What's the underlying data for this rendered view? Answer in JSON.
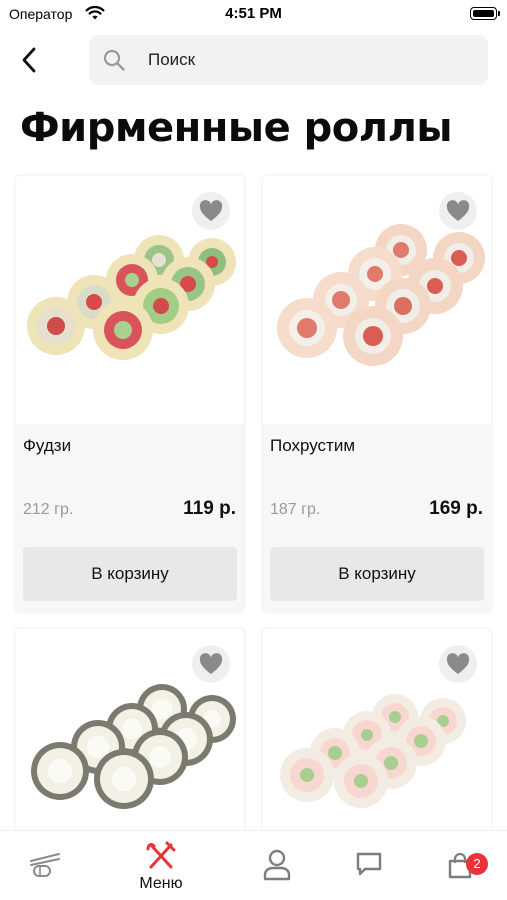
{
  "status_bar": {
    "carrier": "Оператор",
    "time": "4:51 PM"
  },
  "header": {
    "search_placeholder": "Поиск"
  },
  "page": {
    "title": "Фирменные роллы"
  },
  "colors": {
    "accent": "#e8333a",
    "card_bg": "#f7f7f7",
    "button_bg": "#e8e8e8",
    "muted_text": "#9a9a9a"
  },
  "products": [
    {
      "name": "Фудзи",
      "weight": "212 гр.",
      "price": "119 р.",
      "button_label": "В корзину",
      "icon": "heart-icon"
    },
    {
      "name": "Похрустим",
      "weight": "187 гр.",
      "price": "169 р.",
      "button_label": "В корзину",
      "icon": "heart-icon"
    },
    {
      "name": "",
      "weight": "",
      "price": "",
      "button_label": "",
      "icon": "heart-icon"
    },
    {
      "name": "",
      "weight": "",
      "price": "",
      "button_label": "",
      "icon": "heart-icon"
    }
  ],
  "tab_bar": {
    "tabs": [
      {
        "id": "rolls",
        "icon": "sushi-chopsticks-icon",
        "label": ""
      },
      {
        "id": "menu",
        "icon": "fork-knife-icon",
        "label": "Меню",
        "active": true
      },
      {
        "id": "profile",
        "icon": "user-icon",
        "label": ""
      },
      {
        "id": "chat",
        "icon": "chat-icon",
        "label": ""
      },
      {
        "id": "cart",
        "icon": "shopping-bag-icon",
        "label": ""
      }
    ],
    "cart_count": "2"
  }
}
